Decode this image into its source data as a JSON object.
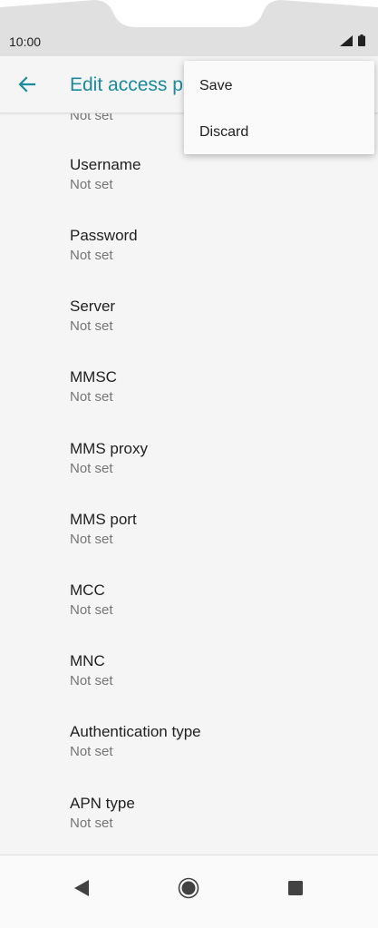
{
  "status_bar": {
    "time": "10:00",
    "icons": [
      "signal-icon",
      "battery-icon"
    ]
  },
  "app_bar": {
    "title": "Edit access p",
    "back_icon": "arrow-left-icon"
  },
  "list": {
    "clipped_value": "Not set",
    "items": [
      {
        "label": "Username",
        "value": "Not set"
      },
      {
        "label": "Password",
        "value": "Not set"
      },
      {
        "label": "Server",
        "value": "Not set"
      },
      {
        "label": "MMSC",
        "value": "Not set"
      },
      {
        "label": "MMS proxy",
        "value": "Not set"
      },
      {
        "label": "MMS port",
        "value": "Not set"
      },
      {
        "label": "MCC",
        "value": "Not set"
      },
      {
        "label": "MNC",
        "value": "Not set"
      },
      {
        "label": "Authentication type",
        "value": "Not set"
      },
      {
        "label": "APN type",
        "value": "Not set"
      }
    ]
  },
  "menu": {
    "items": [
      {
        "label": "Save"
      },
      {
        "label": "Discard"
      }
    ]
  },
  "nav_bar": {
    "icons": [
      "back-triangle-icon",
      "home-circle-icon",
      "recents-square-icon"
    ]
  },
  "colors": {
    "accent": "#1a8a9d",
    "background": "#f5f5f5",
    "status_bar": "#e0e0e0"
  }
}
